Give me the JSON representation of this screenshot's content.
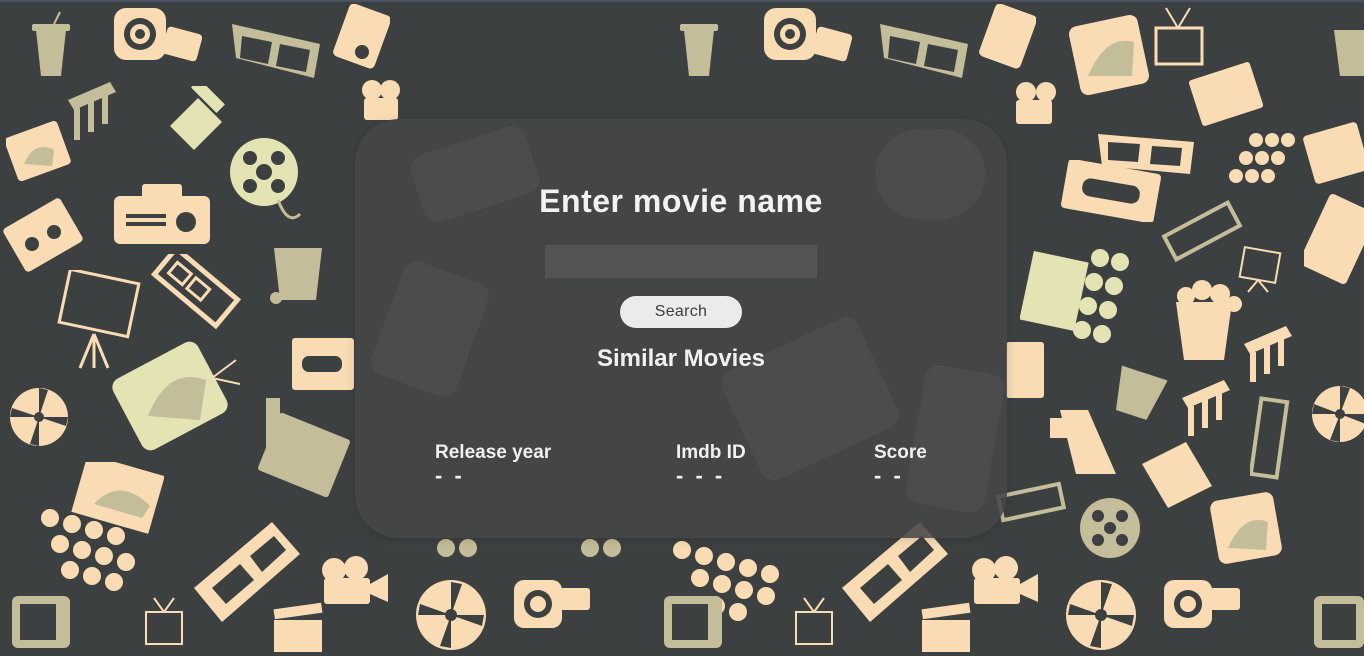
{
  "page": {
    "title": "Enter movie name"
  },
  "search": {
    "value": "",
    "placeholder": "",
    "button_label": "Search"
  },
  "similar": {
    "heading": "Similar Movies"
  },
  "stats": [
    {
      "label": "Release year",
      "value": "- -"
    },
    {
      "label": "Imdb ID",
      "value": "- - -"
    },
    {
      "label": "Score",
      "value": "- -"
    }
  ],
  "background": {
    "icons": [
      "popcorn-cup-icon",
      "camera-icon",
      "3d-glasses-icon",
      "projector-icon",
      "tv-icon",
      "clapperboard-icon",
      "film-reel-icon",
      "film-strip-icon",
      "cinema-seats-icon",
      "megaphone-icon",
      "vhs-tape-icon",
      "movie-screen-icon",
      "popcorn-box-icon",
      "film-camera-icon"
    ],
    "colors": {
      "base": "#3d4040",
      "peach": "#f9dcb4",
      "cream": "#e3e3b4",
      "khaki": "#c3bd9a"
    }
  },
  "card": {
    "color": "#464646"
  }
}
